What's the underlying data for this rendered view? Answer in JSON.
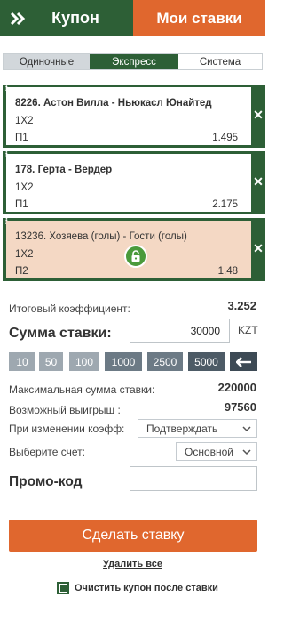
{
  "header": {
    "coupon_label": "Купон",
    "my_bets_label": "Мои ставки"
  },
  "tabs": [
    {
      "label": "Одиночные"
    },
    {
      "label": "Экспресс"
    },
    {
      "label": "Система"
    }
  ],
  "bets": [
    {
      "event": "8226. Астон Вилла - Ньюкасл Юнайтед",
      "market": "1X2",
      "selection": "П1",
      "odds": "1.495",
      "locked": false
    },
    {
      "event": "178. Герта - Вердер",
      "market": "1X2",
      "selection": "П1",
      "odds": "2.175",
      "locked": false
    },
    {
      "event": "13236. Хозяева (голы) - Гости (голы)",
      "market": "1X2",
      "selection": "П2",
      "odds": "1.48",
      "locked": true
    }
  ],
  "summary": {
    "total_odds_label": "Итоговый коэффициент:",
    "total_odds": "3.252",
    "stake_label": "Сумма ставки:",
    "stake_value": "30000",
    "currency": "KZT",
    "quick_amounts": [
      "10",
      "50",
      "100",
      "1000",
      "2500",
      "5000"
    ],
    "max_stake_label": "Максимальная сумма ставки:",
    "max_stake": "220000",
    "possible_win_label": "Возможный выигрыш :",
    "possible_win": "97560",
    "odds_change_label": "При изменении коэфф:",
    "odds_change_value": "Подтверждать",
    "account_label": "Выберите счет:",
    "account_value": "Основной",
    "promo_label": "Промо-код"
  },
  "actions": {
    "place_bet": "Сделать ставку",
    "delete_all": "Удалить все",
    "clear_after": "Очистить купон после ставки"
  },
  "colors": {
    "green": "#2d5f36",
    "orange": "#e0672e",
    "locked_bg": "#f4d8c4"
  }
}
